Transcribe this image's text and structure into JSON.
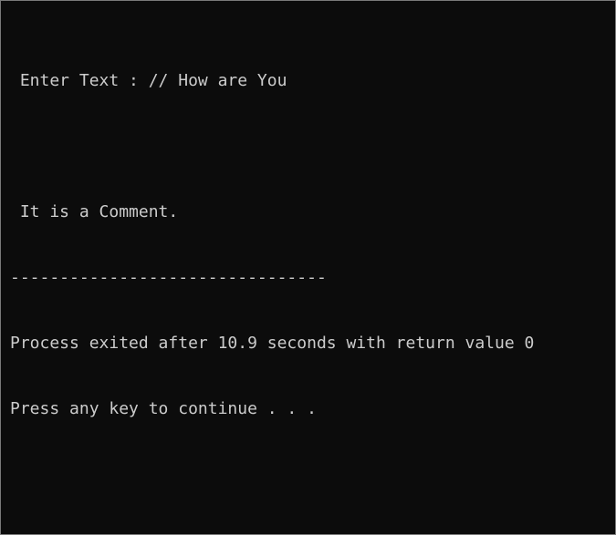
{
  "console": {
    "lines": {
      "prompt": " Enter Text : // How are You",
      "comment": " It is a Comment.",
      "separator": "--------------------------------",
      "exit_status": "Process exited after 10.9 seconds with return value 0",
      "continue_prompt": "Press any key to continue . . ."
    },
    "background_color": "#0c0c0c",
    "text_color": "#cccccc"
  }
}
